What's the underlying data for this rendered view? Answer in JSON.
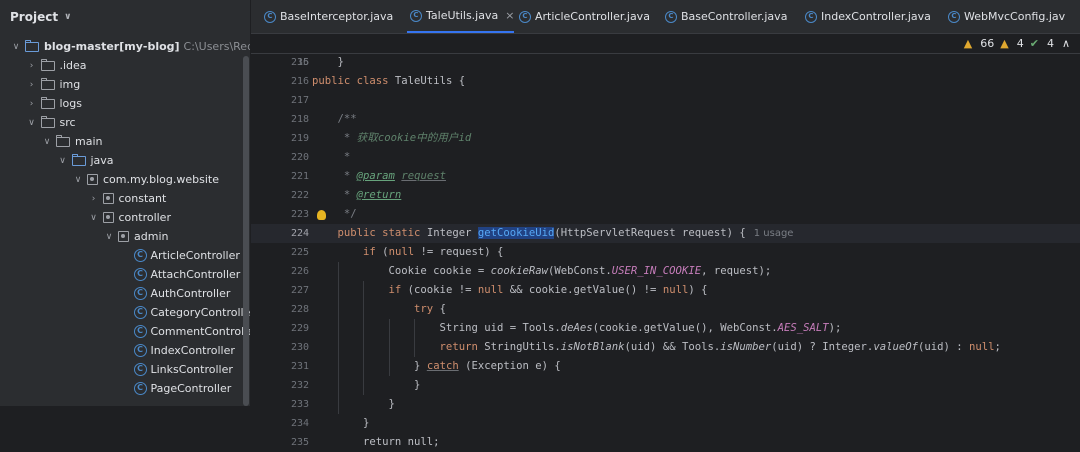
{
  "project": {
    "title": "Project",
    "tree": [
      {
        "label": "blog-master",
        "module": "[my-blog]",
        "path": "C:\\Users\\RedTeam\\",
        "icon": "folder-blue-icon",
        "indent": 0,
        "expanded": true
      },
      {
        "label": ".idea",
        "icon": "folder-icon",
        "indent": 1,
        "expanded": false
      },
      {
        "label": "img",
        "icon": "folder-icon",
        "indent": 1,
        "expanded": false
      },
      {
        "label": "logs",
        "icon": "folder-icon",
        "indent": 1,
        "expanded": false
      },
      {
        "label": "src",
        "icon": "folder-icon",
        "indent": 1,
        "expanded": true
      },
      {
        "label": "main",
        "icon": "folder-icon",
        "indent": 2,
        "expanded": true
      },
      {
        "label": "java",
        "icon": "folder-blue-icon",
        "indent": 3,
        "expanded": true
      },
      {
        "label": "com.my.blog.website",
        "icon": "package-icon",
        "indent": 4,
        "expanded": true
      },
      {
        "label": "constant",
        "icon": "package-icon",
        "indent": 5,
        "expanded": false
      },
      {
        "label": "controller",
        "icon": "package-icon",
        "indent": 5,
        "expanded": true
      },
      {
        "label": "admin",
        "icon": "package-icon",
        "indent": 6,
        "expanded": true
      },
      {
        "label": "ArticleController",
        "icon": "class-icon",
        "indent": 7
      },
      {
        "label": "AttachController",
        "icon": "class-icon",
        "indent": 7
      },
      {
        "label": "AuthController",
        "icon": "class-icon",
        "indent": 7
      },
      {
        "label": "CategoryController",
        "icon": "class-icon",
        "indent": 7
      },
      {
        "label": "CommentController",
        "icon": "class-icon",
        "indent": 7
      },
      {
        "label": "IndexController",
        "icon": "class-icon",
        "indent": 7
      },
      {
        "label": "LinksController",
        "icon": "class-icon",
        "indent": 7
      },
      {
        "label": "PageController",
        "icon": "class-icon",
        "indent": 7
      }
    ]
  },
  "tabs": [
    {
      "label": "BaseInterceptor.java",
      "active": false
    },
    {
      "label": "TaleUtils.java",
      "active": true
    },
    {
      "label": "ArticleController.java",
      "active": false
    },
    {
      "label": "BaseController.java",
      "active": false
    },
    {
      "label": "IndexController.java",
      "active": false
    },
    {
      "label": "WebMvcConfig.jav",
      "active": false
    }
  ],
  "sticky": {
    "line": "36",
    "code": [
      {
        "t": "public class ",
        "c": "kw"
      },
      {
        "t": "TaleUtils {",
        "c": ""
      }
    ]
  },
  "inspections": {
    "warnings": "66",
    "weak_warnings": "4",
    "ok": "4"
  },
  "code_lines": [
    {
      "n": "215",
      "code": [
        {
          "t": "    }",
          "c": ""
        }
      ]
    },
    {
      "n": "216",
      "code": []
    },
    {
      "n": "217",
      "code": []
    },
    {
      "n": "218",
      "code": [
        {
          "t": "    /**",
          "c": "cm"
        }
      ]
    },
    {
      "n": "219",
      "code": [
        {
          "t": "     * ",
          "c": "cm"
        },
        {
          "t": "获取cookie中的用户id",
          "c": "cmi"
        }
      ]
    },
    {
      "n": "220",
      "code": [
        {
          "t": "     *",
          "c": "cm"
        }
      ]
    },
    {
      "n": "221",
      "code": [
        {
          "t": "     * ",
          "c": "cm"
        },
        {
          "t": "@param",
          "c": "tag"
        },
        {
          "t": " ",
          "c": "cm"
        },
        {
          "t": "request",
          "c": "cmi und"
        }
      ]
    },
    {
      "n": "222",
      "code": [
        {
          "t": "     * ",
          "c": "cm"
        },
        {
          "t": "@return",
          "c": "tag"
        }
      ]
    },
    {
      "n": "223",
      "code": [
        {
          "t": "     */",
          "c": "cm"
        }
      ]
    },
    {
      "n": "224",
      "current": true,
      "code": [
        {
          "t": "    public static ",
          "c": "kw"
        },
        {
          "t": "Integer ",
          "c": ""
        },
        {
          "t": "getCookieUid",
          "c": "fn hl"
        },
        {
          "t": "(HttpServletRequest request) {",
          "c": ""
        }
      ],
      "usage": "1 usage"
    },
    {
      "n": "225",
      "code": [
        {
          "t": "        if ",
          "c": "kw"
        },
        {
          "t": "(",
          "c": ""
        },
        {
          "t": "null",
          "c": "kw"
        },
        {
          "t": " != request) {",
          "c": ""
        }
      ]
    },
    {
      "n": "226",
      "code": [
        {
          "t": "            Cookie cookie = ",
          "c": ""
        },
        {
          "t": "cookieRaw",
          "c": "st"
        },
        {
          "t": "(WebConst.",
          "c": ""
        },
        {
          "t": "USER_IN_COOKIE",
          "c": "fld"
        },
        {
          "t": ", request);",
          "c": ""
        }
      ]
    },
    {
      "n": "227",
      "code": [
        {
          "t": "            if ",
          "c": "kw"
        },
        {
          "t": "(cookie != ",
          "c": ""
        },
        {
          "t": "null",
          "c": "kw"
        },
        {
          "t": " && cookie.getValue() != ",
          "c": ""
        },
        {
          "t": "null",
          "c": "kw"
        },
        {
          "t": ") {",
          "c": ""
        }
      ]
    },
    {
      "n": "228",
      "code": [
        {
          "t": "                try ",
          "c": "kw"
        },
        {
          "t": "{",
          "c": ""
        }
      ]
    },
    {
      "n": "229",
      "code": [
        {
          "t": "                    String uid = Tools.",
          "c": ""
        },
        {
          "t": "deAes",
          "c": "st"
        },
        {
          "t": "(cookie.getValue(), WebConst.",
          "c": ""
        },
        {
          "t": "AES_SALT",
          "c": "fld"
        },
        {
          "t": ");",
          "c": ""
        }
      ]
    },
    {
      "n": "230",
      "code": [
        {
          "t": "                    return ",
          "c": "kw"
        },
        {
          "t": "StringUtils.",
          "c": ""
        },
        {
          "t": "isNotBlank",
          "c": "st"
        },
        {
          "t": "(uid) && Tools.",
          "c": ""
        },
        {
          "t": "isNumber",
          "c": "st"
        },
        {
          "t": "(uid) ? Integer.",
          "c": ""
        },
        {
          "t": "valueOf",
          "c": "st"
        },
        {
          "t": "(uid) : ",
          "c": ""
        },
        {
          "t": "null",
          "c": "kw"
        },
        {
          "t": ";",
          "c": ""
        }
      ]
    },
    {
      "n": "231",
      "code": [
        {
          "t": "                } ",
          "c": ""
        },
        {
          "t": "catch",
          "c": "kw und"
        },
        {
          "t": " (Exception e) {",
          "c": ""
        }
      ]
    },
    {
      "n": "232",
      "code": [
        {
          "t": "                }",
          "c": ""
        }
      ]
    },
    {
      "n": "233",
      "code": [
        {
          "t": "            }",
          "c": ""
        }
      ]
    },
    {
      "n": "234",
      "code": [
        {
          "t": "        }",
          "c": ""
        }
      ]
    },
    {
      "n": "235",
      "code": [
        {
          "t": "        return null;",
          "c": ""
        }
      ]
    }
  ]
}
